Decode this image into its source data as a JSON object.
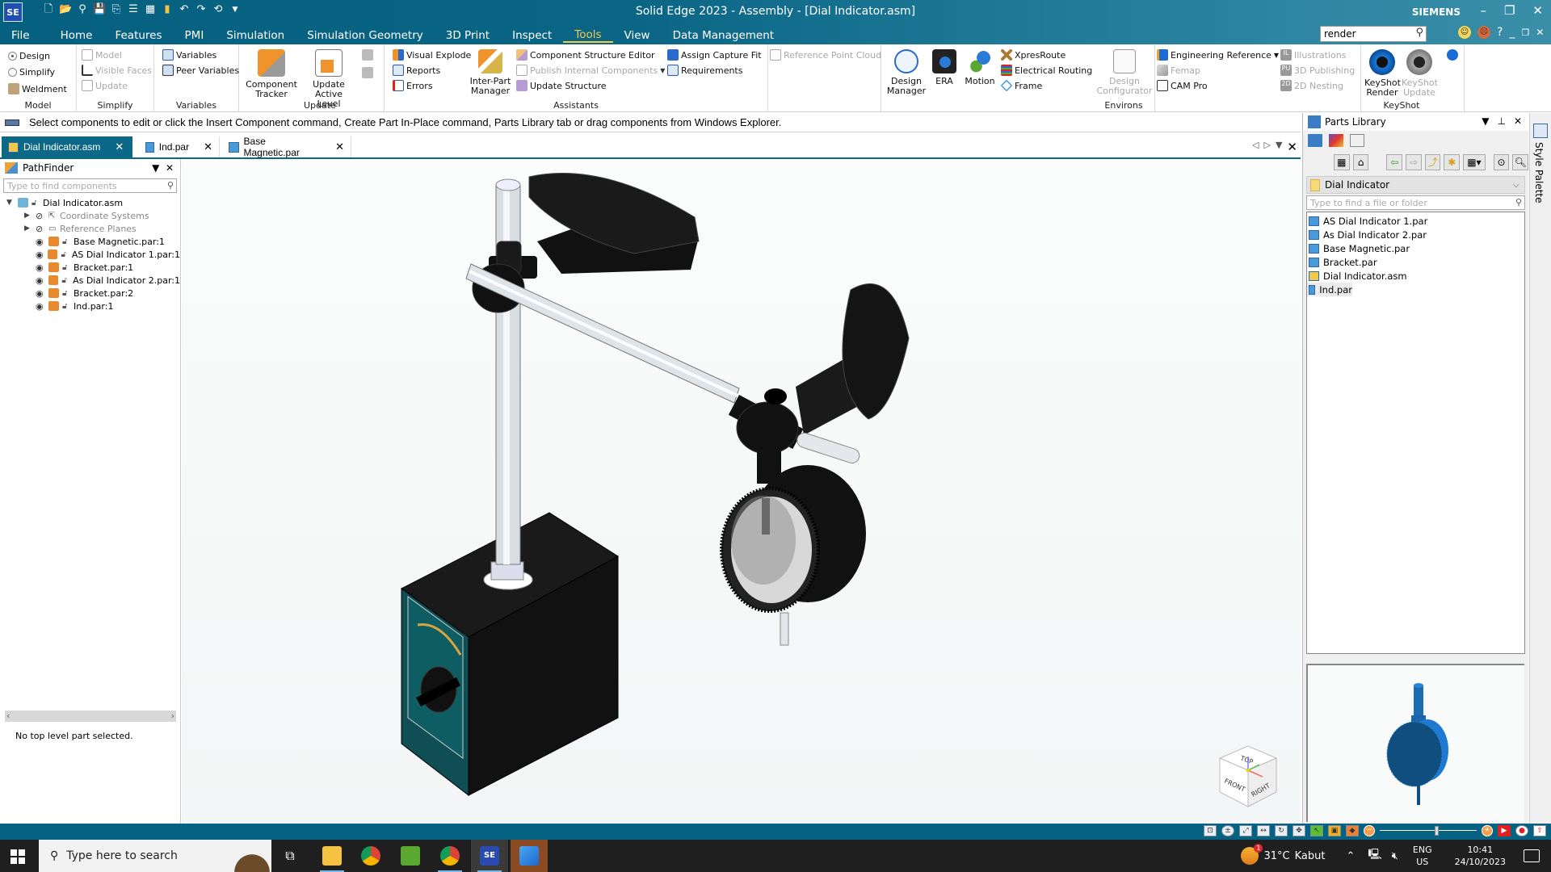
{
  "window": {
    "title": "Solid Edge 2023 - Assembly - [Dial Indicator.asm]",
    "brand": "SIEMENS",
    "app_icon": "SE",
    "controls": [
      "minimize-icon",
      "restore-icon",
      "close-icon"
    ]
  },
  "menu_tabs": [
    {
      "label": "File"
    },
    {
      "label": "Home"
    },
    {
      "label": "Features"
    },
    {
      "label": "PMI"
    },
    {
      "label": "Simulation"
    },
    {
      "label": "Simulation Geometry"
    },
    {
      "label": "3D Print"
    },
    {
      "label": "Inspect"
    },
    {
      "label": "Tools",
      "active": true
    },
    {
      "label": "View"
    },
    {
      "label": "Data Management"
    }
  ],
  "command_search": {
    "value": "render"
  },
  "ribbon": {
    "model": {
      "label": "Model",
      "items": [
        "Design",
        "Simplify",
        "Weldment"
      ],
      "selected": "Design"
    },
    "simplify": {
      "label": "Simplify",
      "items": [
        "Model",
        "Visible Faces",
        "Update"
      ]
    },
    "variables": {
      "label": "Variables",
      "items": [
        "Variables",
        "Peer Variables"
      ]
    },
    "update": {
      "label": "Update",
      "component_tracker": "Component Tracker",
      "update_active_level": "Update Active Level"
    },
    "assistants": {
      "label": "Assistants",
      "items": [
        "Visual Explode",
        "Reports",
        "Errors"
      ],
      "inter_part_manager": "Inter-Part Manager",
      "structure": [
        "Component Structure Editor",
        "Publish Internal Components",
        "Update Structure"
      ],
      "capture": [
        "Assign Capture Fit",
        "Requirements"
      ]
    },
    "reference_point_cloud": "Reference Point Cloud",
    "environs": {
      "label": "Environs",
      "design_manager": "Design Manager",
      "era": "ERA",
      "motion": "Motion",
      "items": [
        "XpresRoute",
        "Electrical Routing",
        "Frame"
      ],
      "design_configurator": "Design Configurator"
    },
    "engineering": {
      "items": [
        "Engineering Reference",
        "Femap",
        "CAM Pro"
      ]
    },
    "publishing": {
      "items": [
        "Illustrations",
        "3D Publishing",
        "2D Nesting"
      ]
    },
    "keyshot": {
      "label": "KeyShot",
      "render": "KeyShot Render",
      "update": "KeyShot Update"
    }
  },
  "prompt_bar": {
    "text": "Select components to edit or click the Insert Component command, Create Part In-Place command, Parts Library tab or drag components from Windows Explorer."
  },
  "doc_tabs": [
    {
      "label": "Dial Indicator.asm",
      "active": true
    },
    {
      "label": "Ind.par"
    },
    {
      "label": "Base Magnetic.par"
    }
  ],
  "pathfinder": {
    "title": "PathFinder",
    "search_placeholder": "Type to find components",
    "root": "Dial Indicator.asm",
    "items": [
      {
        "label": "Coordinate Systems",
        "hidden": true
      },
      {
        "label": "Reference Planes",
        "hidden": true
      },
      {
        "label": "Base Magnetic.par:1"
      },
      {
        "label": "AS Dial Indicator 1.par:1"
      },
      {
        "label": "Bracket.par:1"
      },
      {
        "label": "As Dial Indicator 2.par:1"
      },
      {
        "label": "Bracket.par:2"
      },
      {
        "label": "Ind.par:1"
      }
    ],
    "status": "No top level part selected."
  },
  "viewcube": {
    "faces": [
      "TOP",
      "FRONT",
      "RIGHT"
    ]
  },
  "parts_library": {
    "title": "Parts Library",
    "folder": "Dial Indicator",
    "search_placeholder": "Type to find a file or folder",
    "files": [
      {
        "label": "AS Dial Indicator 1.par",
        "type": "par"
      },
      {
        "label": "As Dial Indicator 2.par",
        "type": "par"
      },
      {
        "label": "Base Magnetic.par",
        "type": "par"
      },
      {
        "label": "Bracket.par",
        "type": "par"
      },
      {
        "label": "Dial Indicator.asm",
        "type": "asm"
      },
      {
        "label": "Ind.par",
        "type": "par",
        "selected": true
      }
    ]
  },
  "style_palette": {
    "label": "Style Palette"
  },
  "taskbar": {
    "search_placeholder": "Type here to search",
    "weather": {
      "temp": "31°C",
      "condition": "Kabut",
      "badge": "1"
    },
    "lang": [
      "ENG",
      "US"
    ],
    "time": "10:41",
    "date": "24/10/2023"
  },
  "colors": {
    "accent": "#0b6887",
    "active_tab": "#f7c948",
    "titlebar": "#06607f"
  }
}
